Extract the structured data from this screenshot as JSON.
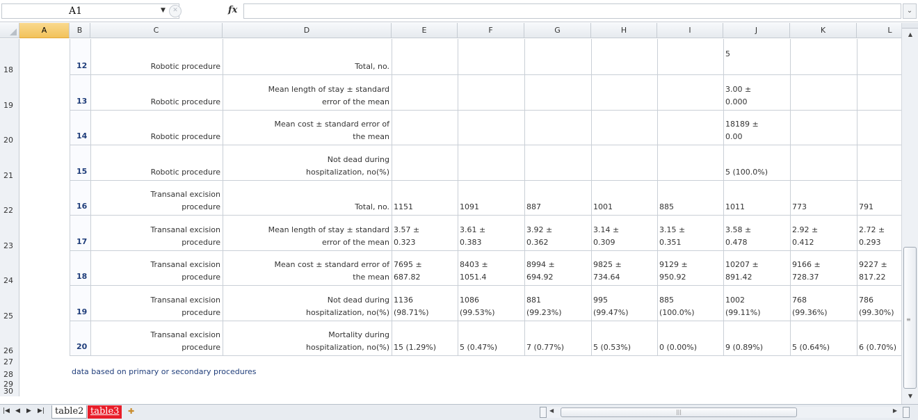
{
  "formula_bar": {
    "name_box": "A1",
    "fx_label": "fx",
    "formula_value": ""
  },
  "columns": [
    "A",
    "B",
    "C",
    "D",
    "E",
    "F",
    "G",
    "H",
    "I",
    "J",
    "K",
    "L"
  ],
  "selected_column": "A",
  "rows": [
    {
      "row_num": "18",
      "id": "12",
      "procedure": [
        "",
        "Robotic procedure"
      ],
      "measure": [
        "",
        "Total, no."
      ],
      "values": [
        [
          "",
          ""
        ],
        [
          "",
          ""
        ],
        [
          "",
          ""
        ],
        [
          "",
          ""
        ],
        [
          "",
          ""
        ],
        [
          "5",
          ""
        ],
        [
          "",
          ""
        ],
        [
          "",
          ""
        ]
      ]
    },
    {
      "row_num": "19",
      "id": "13",
      "procedure": [
        "",
        "Robotic procedure"
      ],
      "measure": [
        "Mean length of stay ± standard",
        "error of the mean"
      ],
      "values": [
        [
          "",
          ""
        ],
        [
          "",
          ""
        ],
        [
          "",
          ""
        ],
        [
          "",
          ""
        ],
        [
          "",
          ""
        ],
        [
          "3.00 ±",
          "0.000"
        ],
        [
          "",
          ""
        ],
        [
          "",
          ""
        ]
      ]
    },
    {
      "row_num": "20",
      "id": "14",
      "procedure": [
        "",
        "Robotic procedure"
      ],
      "measure": [
        "Mean cost ± standard error of",
        "the mean"
      ],
      "values": [
        [
          "",
          ""
        ],
        [
          "",
          ""
        ],
        [
          "",
          ""
        ],
        [
          "",
          ""
        ],
        [
          "",
          ""
        ],
        [
          "18189 ±",
          "0.00"
        ],
        [
          "",
          ""
        ],
        [
          "",
          ""
        ]
      ]
    },
    {
      "row_num": "21",
      "id": "15",
      "procedure": [
        "",
        "Robotic procedure"
      ],
      "measure": [
        "Not dead during",
        "hospitalization, no(%)"
      ],
      "values": [
        [
          "",
          ""
        ],
        [
          "",
          ""
        ],
        [
          "",
          ""
        ],
        [
          "",
          ""
        ],
        [
          "",
          ""
        ],
        [
          "",
          "5 (100.0%)"
        ],
        [
          "",
          ""
        ],
        [
          "",
          ""
        ]
      ]
    },
    {
      "row_num": "22",
      "id": "16",
      "procedure": [
        "Transanal excision",
        "procedure"
      ],
      "measure": [
        "",
        "Total, no."
      ],
      "values": [
        [
          "",
          "1151"
        ],
        [
          "",
          "1091"
        ],
        [
          "",
          "887"
        ],
        [
          "",
          "1001"
        ],
        [
          "",
          "885"
        ],
        [
          "",
          "1011"
        ],
        [
          "",
          "773"
        ],
        [
          "",
          "791"
        ]
      ]
    },
    {
      "row_num": "23",
      "id": "17",
      "procedure": [
        "Transanal excision",
        "procedure"
      ],
      "measure": [
        "Mean length of stay ± standard",
        "error of the mean"
      ],
      "values": [
        [
          "3.57 ±",
          "0.323"
        ],
        [
          "3.61 ±",
          "0.383"
        ],
        [
          "3.92 ±",
          "0.362"
        ],
        [
          "3.14 ±",
          "0.309"
        ],
        [
          "3.15 ±",
          "0.351"
        ],
        [
          "3.58 ±",
          "0.478"
        ],
        [
          "2.92 ±",
          "0.412"
        ],
        [
          "2.72 ±",
          "0.293"
        ]
      ]
    },
    {
      "row_num": "24",
      "id": "18",
      "procedure": [
        "Transanal excision",
        "procedure"
      ],
      "measure": [
        "Mean cost ± standard error of",
        "the mean"
      ],
      "values": [
        [
          "7695 ±",
          "687.82"
        ],
        [
          "8403 ±",
          "1051.4"
        ],
        [
          "8994 ±",
          "694.92"
        ],
        [
          "9825 ±",
          "734.64"
        ],
        [
          "9129 ±",
          "950.92"
        ],
        [
          "10207 ±",
          "891.42"
        ],
        [
          "9166 ±",
          "728.37"
        ],
        [
          "9227 ±",
          "817.22"
        ]
      ]
    },
    {
      "row_num": "25",
      "id": "19",
      "procedure": [
        "Transanal excision",
        "procedure"
      ],
      "measure": [
        "Not dead during",
        "hospitalization, no(%)"
      ],
      "values": [
        [
          "1136",
          "(98.71%)"
        ],
        [
          "1086",
          "(99.53%)"
        ],
        [
          "881",
          "(99.23%)"
        ],
        [
          "995",
          "(99.47%)"
        ],
        [
          "885",
          "(100.0%)"
        ],
        [
          "1002",
          "(99.11%)"
        ],
        [
          "768",
          "(99.36%)"
        ],
        [
          "786",
          "(99.30%)"
        ]
      ]
    },
    {
      "row_num": "26",
      "id": "20",
      "procedure": [
        "Transanal excision",
        "procedure"
      ],
      "measure": [
        "Mortality during",
        "hospitalization, no(%)"
      ],
      "values": [
        [
          "",
          "15 (1.29%)"
        ],
        [
          "",
          "5 (0.47%)"
        ],
        [
          "",
          "7 (0.77%)"
        ],
        [
          "",
          "5 (0.53%)"
        ],
        [
          "",
          "0 (0.00%)"
        ],
        [
          "",
          "9 (0.89%)"
        ],
        [
          "",
          "5 (0.64%)"
        ],
        [
          "",
          "6 (0.70%)"
        ]
      ]
    }
  ],
  "extra_rows": [
    "27",
    "28",
    "29",
    "30"
  ],
  "footnote": "data based on primary or secondary procedures",
  "sheet_tabs": [
    {
      "label": "table2",
      "active": true
    },
    {
      "label": "table3",
      "active": false
    }
  ],
  "colors": {
    "tab_highlight": "#e81e2a",
    "selected_header": "#f2c25a",
    "id_text": "#1f3d7a"
  }
}
